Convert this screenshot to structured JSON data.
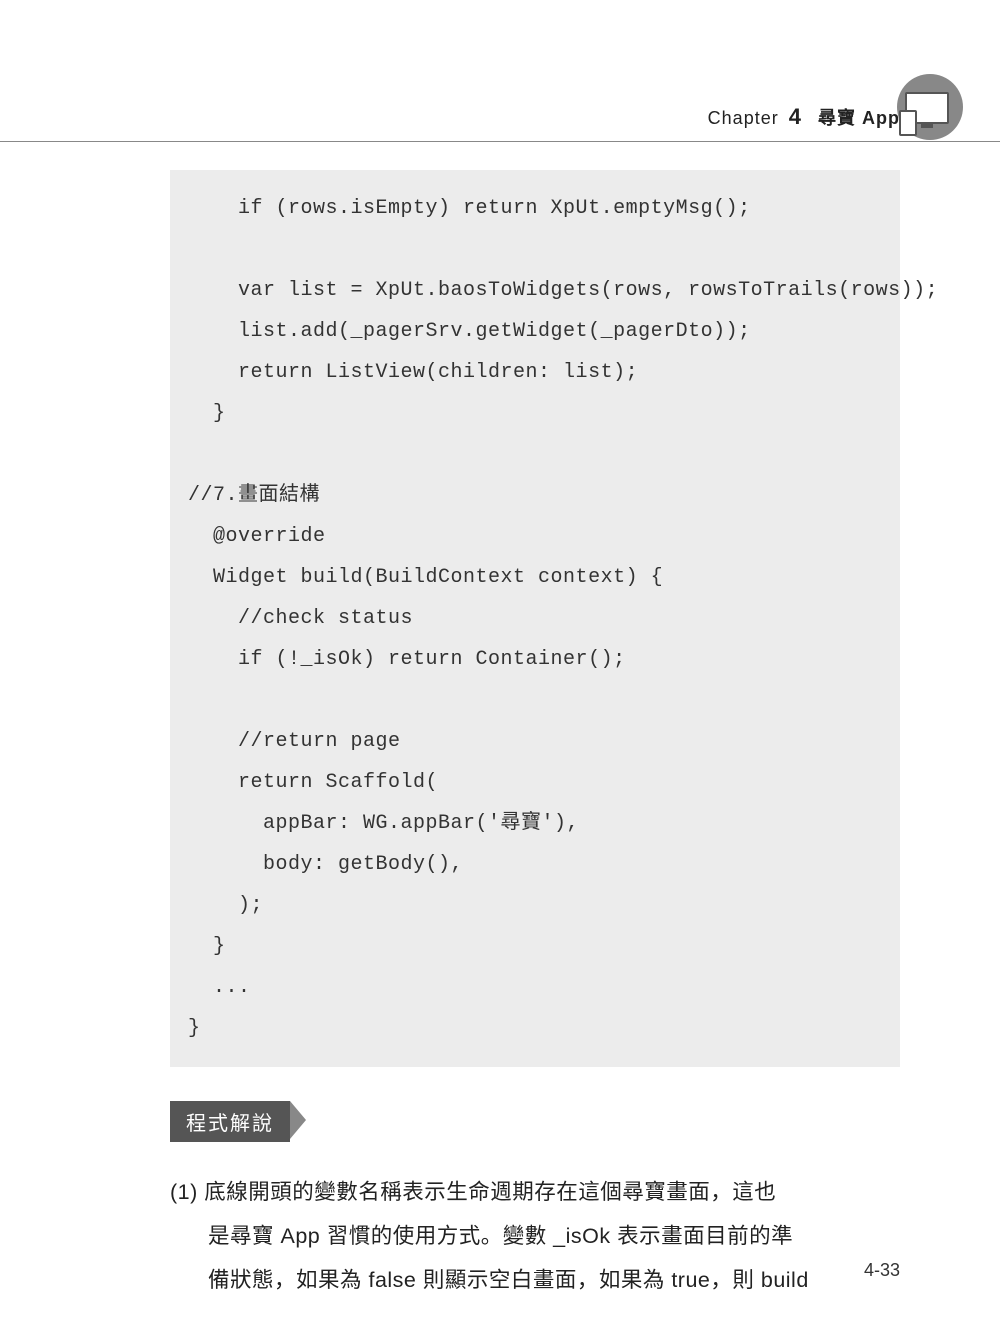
{
  "header": {
    "chapter_word": "Chapter",
    "chapter_num": "4",
    "chapter_title": "尋寶 App"
  },
  "code": "    if (rows.isEmpty) return XpUt.emptyMsg();\n\n    var list = XpUt.baosToWidgets(rows, rowsToTrails(rows));\n    list.add(_pagerSrv.getWidget(_pagerDto));\n    return ListView(children: list);\n  }\n\n//7.畫面結構\n  @override\n  Widget build(BuildContext context) {\n    //check status\n    if (!_isOk) return Container();\n\n    //return page\n    return Scaffold(\n      appBar: WG.appBar('尋寶'),\n      body: getBody(),\n    );\n  }\n  ...\n}",
  "section": {
    "badge": "程式解說"
  },
  "paragraph": {
    "line1": "(1) 底線開頭的變數名稱表示生命週期存在這個尋寶畫面，這也",
    "line2": "是尋寶 App 習慣的使用方式。變數 _isOk 表示畫面目前的準",
    "line3": "備狀態，如果為 false 則顯示空白畫面，如果為 true，則 build"
  },
  "page_num": "4-33"
}
